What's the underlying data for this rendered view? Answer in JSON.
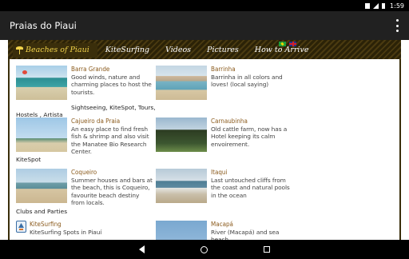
{
  "status_bar": {
    "time": "1:59",
    "icons": [
      "data-lte-icon",
      "signal-icon",
      "battery-icon"
    ]
  },
  "app_bar": {
    "title": "Praias do Piaui",
    "menu_icon": "overflow-menu-icon"
  },
  "nav": {
    "items": [
      {
        "label": "Beaches of Piaui",
        "active": true,
        "icon": "palm-tree-icon"
      },
      {
        "label": "KiteSurfing"
      },
      {
        "label": "Videos"
      },
      {
        "label": "Pictures"
      },
      {
        "label": "How to Arrive"
      }
    ],
    "flags": [
      "brazil-flag-icon",
      "uk-flag-icon"
    ],
    "active_color": "#f2d34b"
  },
  "places": [
    {
      "title": "Barra Grande",
      "desc": "Good winds, nature and charming places to host the tourists.",
      "tags_inline": "Sightseeing, KiteSpot, Tours,",
      "tags_wrap": "Hostels , Artista"
    },
    {
      "title": "Barrinha",
      "desc": "Barrinha in all colors and loves! (local saying)"
    },
    {
      "title": "Cajueiro da Praia",
      "desc": "An easy place to find fresh fish & shrimp and also visit the Manatee Bio Research Center.",
      "tags_wrap": "KiteSpot"
    },
    {
      "title": "Carnaubinha",
      "desc": "Old cattle farm, now has a Hotel keeping its calm envoirement."
    },
    {
      "title": "Coqueiro",
      "desc": "Summer houses and bars at the beach, this is Coqueiro, favourite beach destiny from locals.",
      "tags_wrap": "Clubs and Parties"
    },
    {
      "title": "Itaqui",
      "desc": "Last untouched cliffs from the coast and natural pools in the ocean"
    },
    {
      "title": "KiteSurfing",
      "desc": "KiteSurfing Spots in Piauí",
      "icon": "kitesurf-app-icon"
    },
    {
      "title": "Macapá",
      "desc": "River (Macapá) and sea beach"
    }
  ],
  "system_nav": {
    "icons": [
      "back-icon",
      "home-icon",
      "recents-icon"
    ]
  }
}
